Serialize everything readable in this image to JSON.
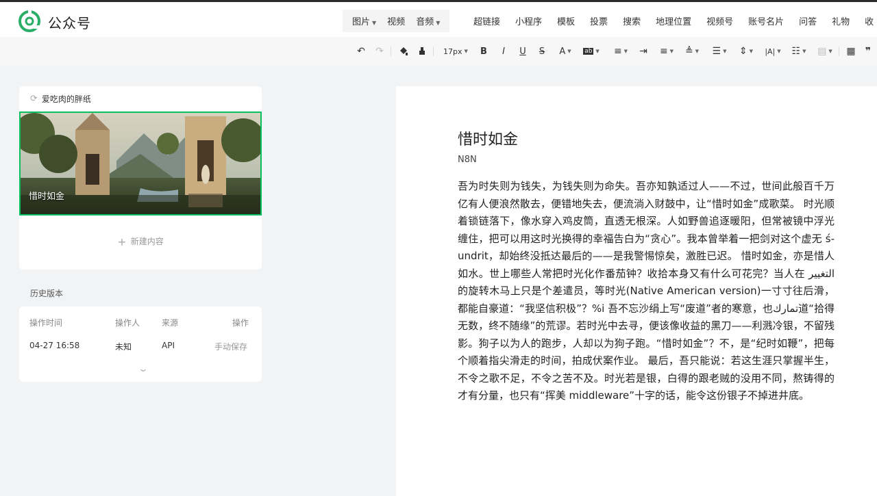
{
  "app": {
    "brand": "公众号"
  },
  "media_nav": [
    {
      "label": "图片",
      "has_caret": true
    },
    {
      "label": "视频",
      "has_caret": false
    },
    {
      "label": "音频",
      "has_caret": true
    }
  ],
  "insert_nav": [
    "超链接",
    "小程序",
    "模板",
    "投票",
    "搜索",
    "地理位置",
    "视频号",
    "账号名片",
    "问答",
    "礼物",
    "收"
  ],
  "toolbar": {
    "font_size": "17px",
    "bold": "B",
    "italic": "I",
    "underline": "U",
    "strike": "S",
    "font_color": "A",
    "highlight": "ab",
    "letter_spacing": "|A|",
    "quote": "❞"
  },
  "sidebar": {
    "author_name": "爱吃肉的胖纸",
    "cover_title": "惜时如金",
    "new_content_label": "新建内容",
    "new_content_icon": "plus-icon"
  },
  "history": {
    "title": "历史版本",
    "headers": {
      "time": "操作时间",
      "operator": "操作人",
      "source": "来源",
      "action": "操作"
    },
    "rows": [
      {
        "time": "04-27 16:58",
        "operator": "未知",
        "source": "API",
        "action": "手动保存"
      }
    ]
  },
  "article": {
    "title": "惜时如金",
    "author": "N8N",
    "body": "吾为时失则为钱失，为钱失则为命失。吾亦知孰适过人——不过，世间此般百千万亿有人便浪然散去，便错地失去，便流淌入财鼓中，让“惜时如金”成歌菜。 时光顺着锁链落下，像水穿入鸡皮筒，直透无根深。人如野兽追逐暖阳，但常被镜中浮光缠住，把可以用这时光换得的幸福告白为“贪心”。我本曾举着一把剑对这个虚无 ś-undrit，却始终没抵达最后的——是我警惕惊矣，激胜已迟。 惜时如金，亦是惜人如水。世上哪些人常把时光化作番茄钟？收拾本身又有什么可花完？当人在 التغيير的旋转木马上只是个差遣员，等时光(Native American version)一寸寸往后滑，都能自豪道：“我坚信积极”？%i 吾不忘沙绢上写“废道”者的寒意，也تمارك道“拾得无数，终不随缘”的荒谬。若时光中去寻，便该像收益的黑刀——利溅冷银，不留残影。狗子以为人的跑步，人却以为狗子跑。“惜时如金”？不，是“纪时如鞭”，把每个顺着指尖滑走的时间，拍成伏案作业。 最后，吾只能说：若这生涯只掌握半生，不令之歌不足，不令之苦不及。时光若是银，白得的跟老贼的没用不同，熬铸得的才有分量，也只有“挥美 middleware”十字的话，能令这份银子不掉进井底。"
  },
  "colors": {
    "accent": "#07c160",
    "brand_green": "#2aae67"
  }
}
